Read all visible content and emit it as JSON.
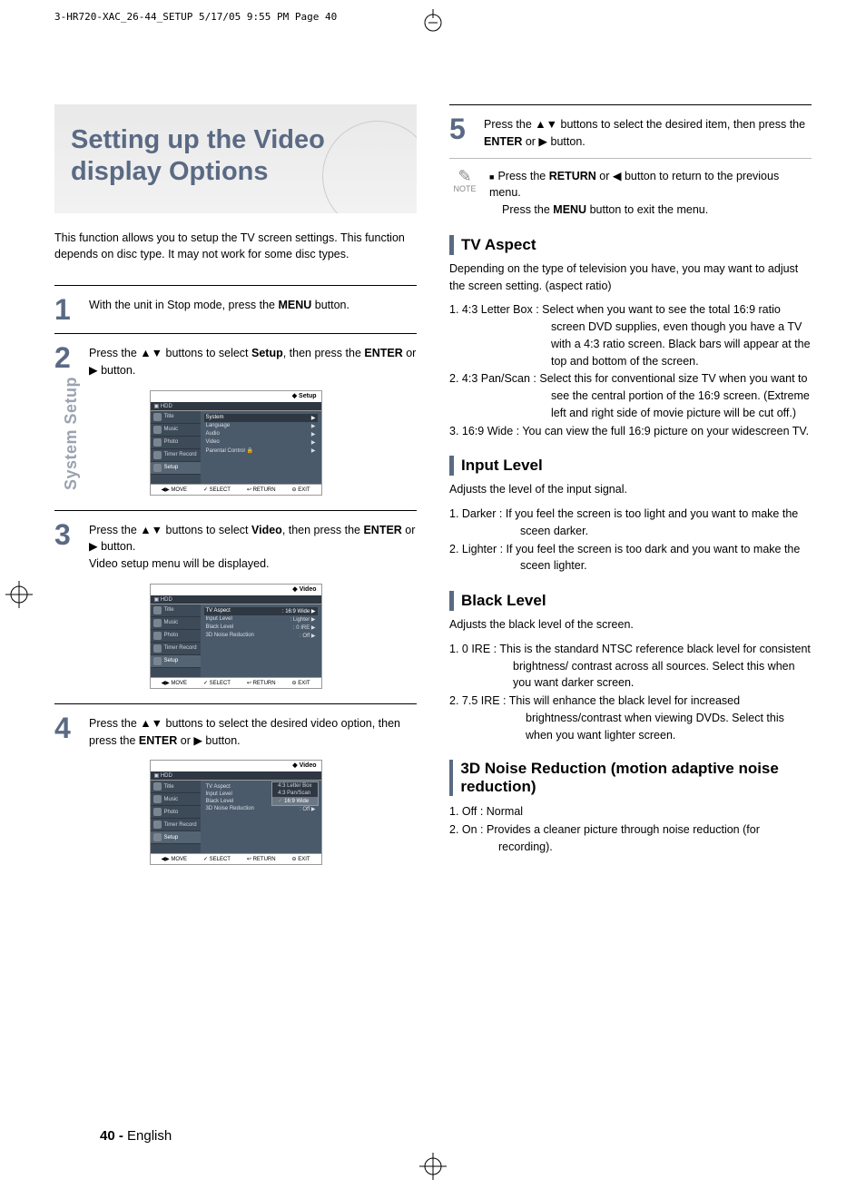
{
  "header_file": "3-HR720-XAC_26-44_SETUP  5/17/05  9:55 PM  Page 40",
  "side_label": "System Setup",
  "title": "Setting up the Video display Options",
  "intro": "This function allows you to setup the TV screen settings. This function depends on disc type. It may not work for some disc types.",
  "steps": {
    "s1": {
      "num": "1",
      "html": "With the unit in Stop mode, press the <b>MENU</b> button."
    },
    "s2": {
      "num": "2",
      "html": "Press the ▲▼ buttons to select <b>Setup</b>, then press the <b>ENTER</b> or ▶ button."
    },
    "s3": {
      "num": "3",
      "html": "Press the ▲▼ buttons to select <b>Video</b>, then press the <b>ENTER</b> or ▶ button.<br>Video setup menu will be displayed."
    },
    "s4": {
      "num": "4",
      "html": "Press the ▲▼ buttons to select the desired video option, then press the <b>ENTER</b> or ▶ button."
    },
    "s5": {
      "num": "5",
      "html": "Press the ▲▼ buttons to select the desired item, then press the <b>ENTER</b> or ▶ button."
    }
  },
  "note": {
    "label": "NOTE",
    "line1": "Press the <b>RETURN</b> or ◀ button to return to the previous menu.",
    "line2": "Press the <b>MENU</b> button to exit the menu."
  },
  "osd_common": {
    "hdd": "HDD",
    "side": [
      "Title",
      "Music",
      "Photo",
      "Timer Record",
      "Setup"
    ],
    "bottom": [
      "◀▶ MOVE",
      "✓ SELECT",
      "↩ RETURN",
      "⊖ EXIT"
    ]
  },
  "osd1": {
    "top": "◆  Setup",
    "rows": [
      {
        "l": "System",
        "r": "▶",
        "sel": true
      },
      {
        "l": "Language",
        "r": "▶"
      },
      {
        "l": "Audio",
        "r": "▶"
      },
      {
        "l": "Video",
        "r": "▶"
      },
      {
        "l": "Parental Control  🔒",
        "r": "▶"
      }
    ]
  },
  "osd2": {
    "top": "◆  Video",
    "rows": [
      {
        "l": "TV Aspect",
        "r": ": 16:9 Wide  ▶",
        "sel": true
      },
      {
        "l": "Input Level",
        "r": ": Lighter    ▶"
      },
      {
        "l": "Black Level",
        "r": ": 0 IRE      ▶"
      },
      {
        "l": "3D Noise Reduction",
        "r": ": Off        ▶"
      }
    ]
  },
  "osd3": {
    "top": "◆  Video",
    "rows": [
      {
        "l": "TV Aspect",
        "r": ""
      },
      {
        "l": "Input Level",
        "r": ""
      },
      {
        "l": "Black Level",
        "r": ""
      },
      {
        "l": "3D Noise Reduction",
        "r": ": Off        ▶"
      }
    ],
    "dropdown": [
      {
        "t": "4:3 Letter Box"
      },
      {
        "t": "4:3 Pan/Scan"
      },
      {
        "t": "16:9 Wide",
        "sel": true
      }
    ]
  },
  "sections": {
    "tv": {
      "title": "TV Aspect",
      "intro": "Depending on the type of television you have, you may want to adjust the screen setting. (aspect ratio)",
      "items": [
        "1. 4:3 Letter  Box : Select when you want to see the total 16:9 ratio screen DVD supplies, even though you have a TV with a 4:3 ratio screen. Black bars will appear at the top and bottom of the screen.",
        "2. 4:3 Pan/Scan : Select this for conventional size TV when you want to see the central portion of the 16:9 screen. (Extreme left and right side of movie picture will be cut off.)",
        "3. 16:9 Wide : You can view the full 16:9 picture on your widescreen TV."
      ]
    },
    "input": {
      "title": "Input Level",
      "intro": "Adjusts the level of the input signal.",
      "items": [
        "1. Darker : If you feel the screen is too light and you want to make the sceen darker.",
        "2. Lighter : If you feel the screen is too dark and you want to make the sceen lighter."
      ]
    },
    "black": {
      "title": "Black Level",
      "intro": "Adjusts the black level of the screen.",
      "items": [
        "1. 0 IRE : This is the standard NTSC reference black level for consistent brightness/ contrast across all sources. Select this when you want darker screen.",
        "2. 7.5 IRE : This will  enhance the black level for increased brightness/contrast when viewing DVDs. Select this when you want lighter screen."
      ]
    },
    "noise": {
      "title": "3D Noise Reduction (motion adaptive noise reduction)",
      "items": [
        "1. Off : Normal",
        "2. On : Provides a cleaner picture through noise reduction (for recording)."
      ]
    }
  },
  "footer": {
    "page": "40 -",
    "lang": "English"
  }
}
